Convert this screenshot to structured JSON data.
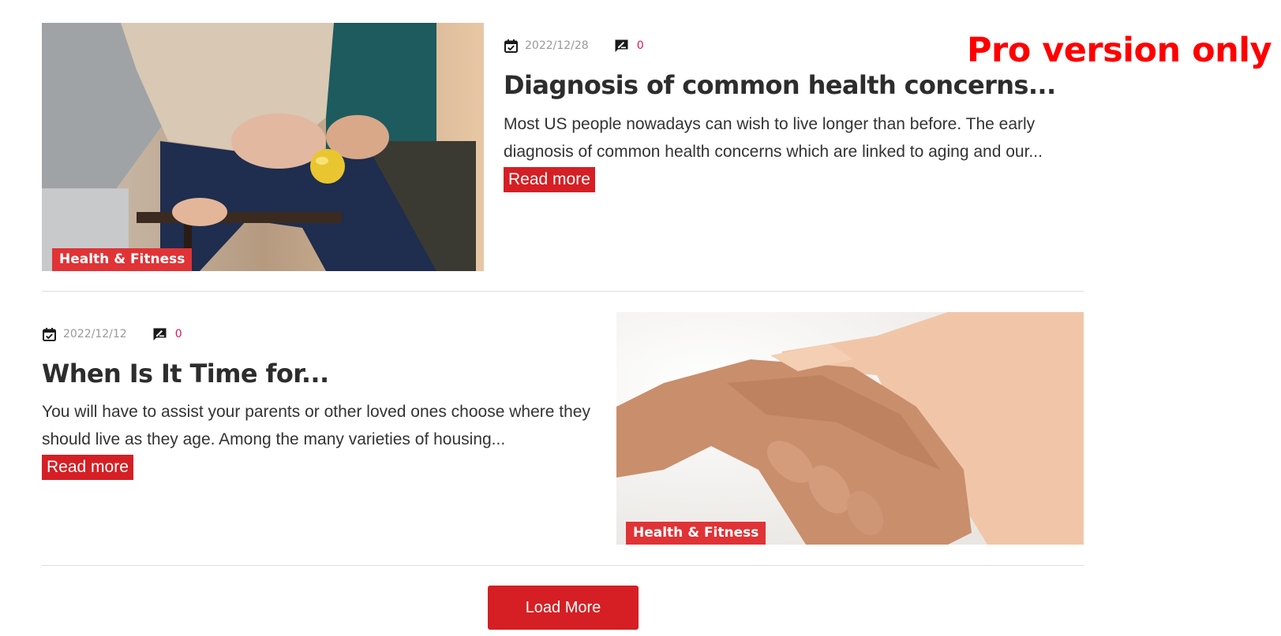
{
  "colors": {
    "accent": "#d51f24",
    "tag_bg": "#e03336",
    "pro_text": "#ff0000",
    "comment_count": "#e0155b"
  },
  "pro_badge": "Pro version only",
  "posts": [
    {
      "date": "2022/12/28",
      "comments": "0",
      "title": "Diagnosis of common health concerns...",
      "excerpt": "Most US people nowadays can wish to live longer than before. The early diagnosis of common health concerns which are linked to aging and our...",
      "read_more": "Read more",
      "category": "Health & Fitness",
      "date_icon": "calendar-check-icon",
      "comment_icon": "comment-edit-icon"
    },
    {
      "date": "2022/12/12",
      "comments": "0",
      "title": "When Is It Time for...",
      "excerpt": "You will have to assist your parents or other loved ones choose where they should live as they age. Among the many varieties of housing...",
      "read_more": "Read more",
      "category": "Health & Fitness",
      "date_icon": "calendar-check-icon",
      "comment_icon": "comment-edit-icon"
    }
  ],
  "load_more": "Load More"
}
